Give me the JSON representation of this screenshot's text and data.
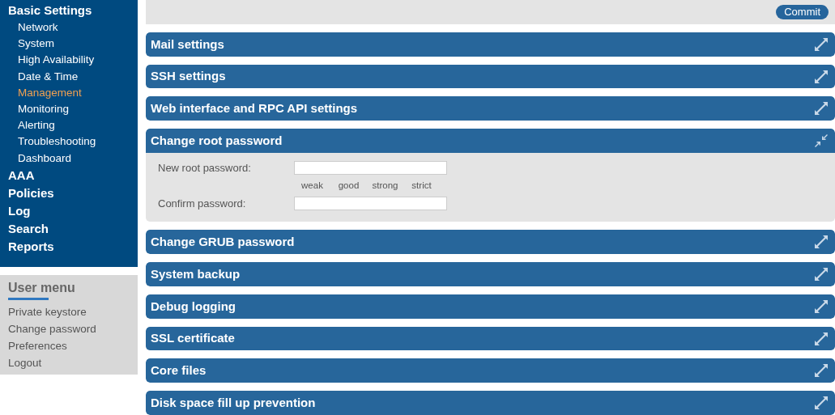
{
  "nav": [
    {
      "label": "Basic Settings",
      "selected": false,
      "children": [
        {
          "label": "Network",
          "selected": false
        },
        {
          "label": "System",
          "selected": false
        },
        {
          "label": "High Availability",
          "selected": false
        },
        {
          "label": "Date & Time",
          "selected": false
        },
        {
          "label": "Management",
          "selected": true
        },
        {
          "label": "Monitoring",
          "selected": false
        },
        {
          "label": "Alerting",
          "selected": false
        },
        {
          "label": "Troubleshooting",
          "selected": false
        },
        {
          "label": "Dashboard",
          "selected": false
        }
      ]
    },
    {
      "label": "AAA",
      "selected": false
    },
    {
      "label": "Policies",
      "selected": false
    },
    {
      "label": "Log",
      "selected": false
    },
    {
      "label": "Search",
      "selected": false
    },
    {
      "label": "Reports",
      "selected": false
    }
  ],
  "user_menu": {
    "title": "User menu",
    "items": [
      "Private keystore",
      "Change password",
      "Preferences",
      "Logout"
    ]
  },
  "commit_button": "Commit",
  "sections": [
    {
      "title": "Mail settings",
      "expanded": false
    },
    {
      "title": "SSH settings",
      "expanded": false
    },
    {
      "title": "Web interface and RPC API settings",
      "expanded": false
    },
    {
      "title": "Change root password",
      "expanded": true,
      "fields": [
        {
          "label": "New root password:",
          "strength": [
            "weak",
            "good",
            "strong",
            "strict"
          ]
        },
        {
          "label": "Confirm password:"
        }
      ]
    },
    {
      "title": "Change GRUB password",
      "expanded": false
    },
    {
      "title": "System backup",
      "expanded": false
    },
    {
      "title": "Debug logging",
      "expanded": false
    },
    {
      "title": "SSL certificate",
      "expanded": false
    },
    {
      "title": "Core files",
      "expanded": false
    },
    {
      "title": "Disk space fill up prevention",
      "expanded": false
    }
  ]
}
